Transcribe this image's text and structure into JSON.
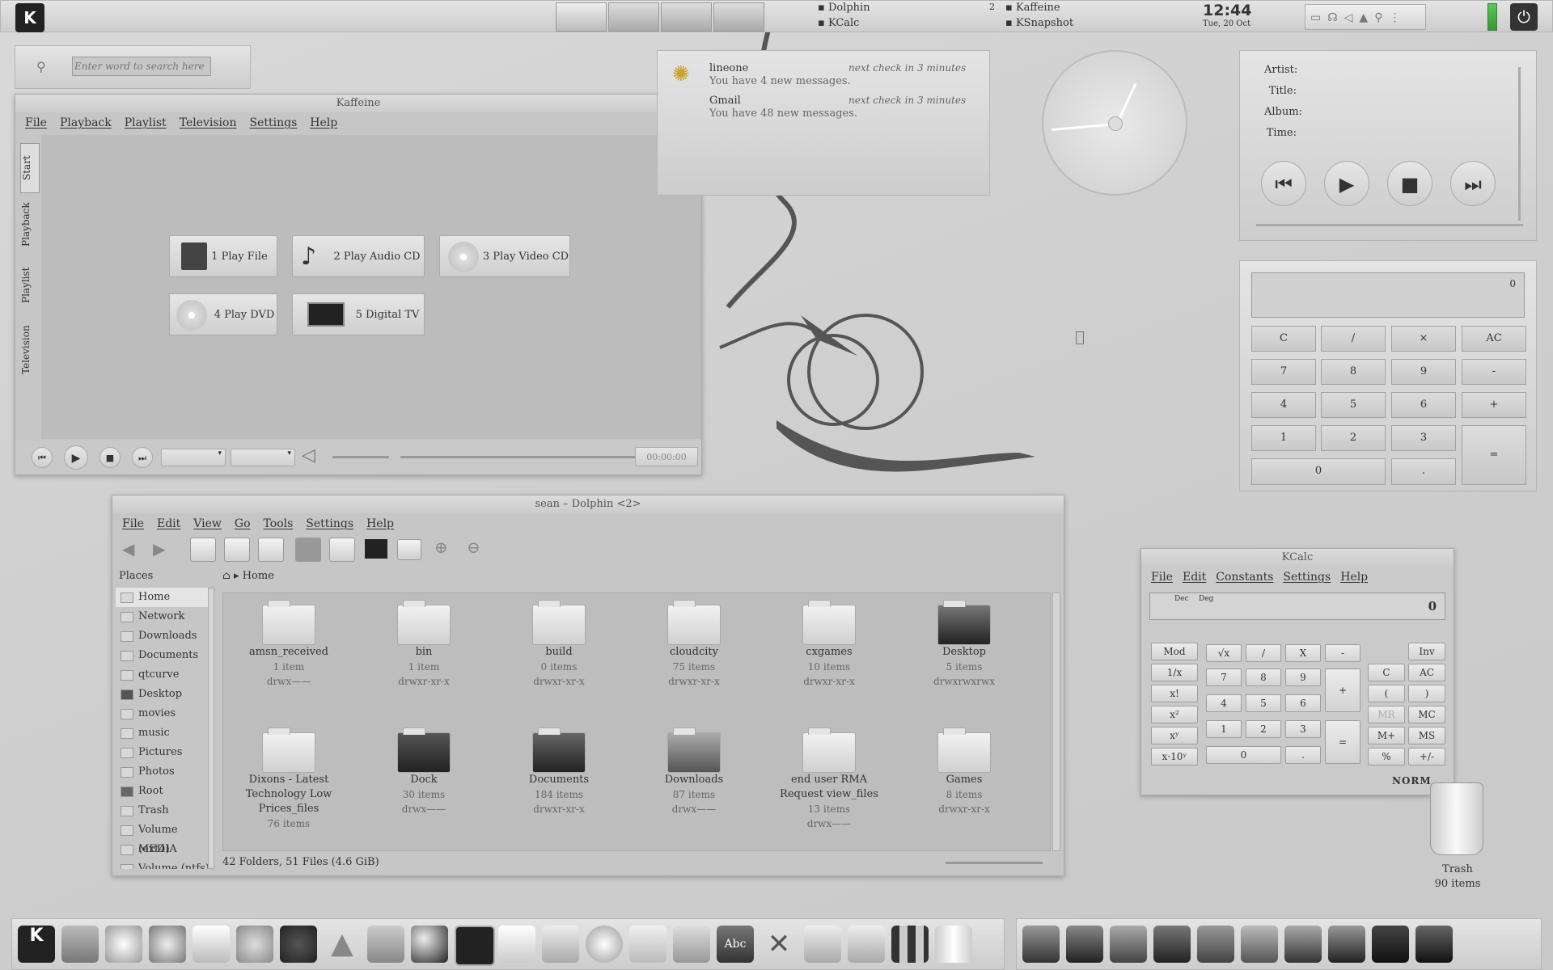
{
  "top_panel": {
    "tasks": [
      "Dolphin",
      "KCalc",
      "Kaffeine",
      "KSnapshot"
    ],
    "desktop_num": "2",
    "clock_time": "12:44",
    "clock_date": "Tue, 20 Oct"
  },
  "search": {
    "placeholder": "Enter word to search here"
  },
  "kaffeine": {
    "title": "Kaffeine",
    "menu": [
      "File",
      "Playback",
      "Playlist",
      "Television",
      "Settings",
      "Help"
    ],
    "side_tabs": [
      "Start",
      "Playback",
      "Playlist",
      "Television"
    ],
    "buttons": [
      "1 Play File",
      "2 Play Audio CD",
      "3 Play Video CD",
      "4 Play DVD",
      "5 Digital TV"
    ],
    "time": "00:00:00"
  },
  "mail": [
    {
      "account": "lineone",
      "message": "You have 4 new messages.",
      "next": "next check in 3 minutes"
    },
    {
      "account": "Gmail",
      "message": "You have 48 new messages.",
      "next": "next check in 3 minutes"
    }
  ],
  "nowplaying": {
    "labels": [
      "Artist:",
      "Title:",
      "Album:",
      "Time:"
    ]
  },
  "calc_widget": {
    "display": "0",
    "keys": [
      "C",
      "/",
      "×",
      "AC",
      "7",
      "8",
      "9",
      "-",
      "4",
      "5",
      "6",
      "+",
      "1",
      "2",
      "3",
      "=",
      "0",
      "."
    ]
  },
  "dolphin": {
    "title": "sean – Dolphin <2>",
    "menu": [
      "File",
      "Edit",
      "View",
      "Go",
      "Tools",
      "Settings",
      "Help"
    ],
    "places_title": "Places",
    "places": [
      "Home",
      "Network",
      "Downloads",
      "Documents",
      "qtcurve",
      "Desktop",
      "movies",
      "music",
      "Pictures",
      "Photos",
      "Root",
      "Trash",
      "Volume (ext4)",
      "MEDIA",
      "Volume (ntfs)"
    ],
    "breadcrumb": "Home",
    "items": [
      {
        "name": "amsn_received",
        "count": "1 item",
        "perm": "drwx——"
      },
      {
        "name": "bin",
        "count": "1 item",
        "perm": "drwxr-xr-x"
      },
      {
        "name": "build",
        "count": "0 items",
        "perm": "drwxr-xr-x"
      },
      {
        "name": "cloudcity",
        "count": "75 items",
        "perm": "drwxr-xr-x"
      },
      {
        "name": "cxgames",
        "count": "10 items",
        "perm": "drwxr-xr-x"
      },
      {
        "name": "Desktop",
        "count": "5 items",
        "perm": "drwxrwxrwx"
      },
      {
        "name": "Dixons - Latest Technology Low Prices_files",
        "count": "76 items",
        "perm": ""
      },
      {
        "name": "Dock",
        "count": "30 items",
        "perm": "drwx——"
      },
      {
        "name": "Documents",
        "count": "184 items",
        "perm": "drwxr-xr-x"
      },
      {
        "name": "Downloads",
        "count": "87 items",
        "perm": "drwx——"
      },
      {
        "name": "end user RMA Request view_files",
        "count": "13 items",
        "perm": "drwx——"
      },
      {
        "name": "Games",
        "count": "8 items",
        "perm": "drwxr-xr-x"
      }
    ],
    "status": "42 Folders, 51 Files (4.6 GiB)"
  },
  "kcalc": {
    "title": "KCalc",
    "menu": [
      "File",
      "Edit",
      "Constants",
      "Settings",
      "Help"
    ],
    "mode1": "Dec",
    "mode2": "Deg",
    "display": "0",
    "left": [
      "Mod",
      "1/x",
      "x!",
      "x²",
      "xʸ",
      "x·10ʸ"
    ],
    "num": [
      "√x",
      "/",
      "X",
      "-",
      "7",
      "8",
      "9",
      "+",
      "4",
      "5",
      "6",
      "1",
      "2",
      "3",
      "=",
      "0",
      "."
    ],
    "right": [
      "Inv",
      "C",
      "AC",
      "(",
      ")",
      "MR",
      "MC",
      "M+",
      "MS",
      "%",
      "+/-"
    ],
    "status": "NORM"
  },
  "trash": {
    "label": "Trash",
    "count": "90 items"
  }
}
